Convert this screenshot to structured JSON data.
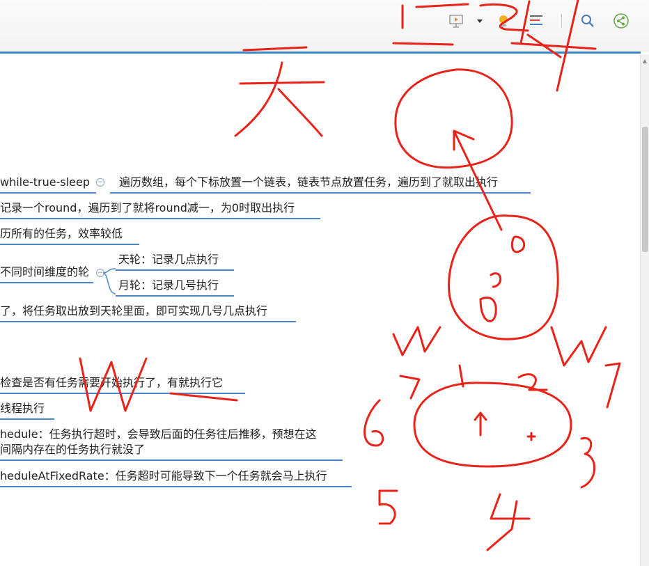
{
  "toolbar": {
    "icons": [
      "presentation-icon",
      "dropdown-arrow-icon",
      "bulb-icon",
      "outline-icon",
      "search-icon",
      "share-icon"
    ],
    "accent": "#3d86c9"
  },
  "mindmap": {
    "node_while": "while-true-sleep",
    "node_traverse": "遍历数组，每个下标放置一个链表，链表节点放置任务，遍历到了就取出执行",
    "node_round": "记录一个round，遍历到了就将round减一，为0时取出执行",
    "node_all": "历所有的任务，效率较低",
    "node_wheel": "不同时间维度的轮",
    "node_day": "天轮：记录几点执行",
    "node_month": "月轮：记录几号执行",
    "node_move": "了，将任务取出放到天轮里面，即可实现几号几点执行",
    "node_check": "检查是否有任务需要开始执行了，有就执行它",
    "node_thread": "线程执行",
    "node_schedule_1": "hedule：任务执行超时，会导致后面的任务往后推移，预想在这",
    "node_schedule_2": "间隔内存在的任务执行就没了",
    "node_fixed": "heduleAtFixedRate：任务超时可能导致下一个任务就会马上执行",
    "line_color": "#4a86c8"
  },
  "annotations": {
    "ink_color": "#e8231a",
    "labels": [
      "天",
      "0",
      "0",
      "0",
      "W",
      "W",
      "7",
      "1",
      "2",
      "6",
      "3",
      "5",
      "4",
      "W"
    ]
  }
}
